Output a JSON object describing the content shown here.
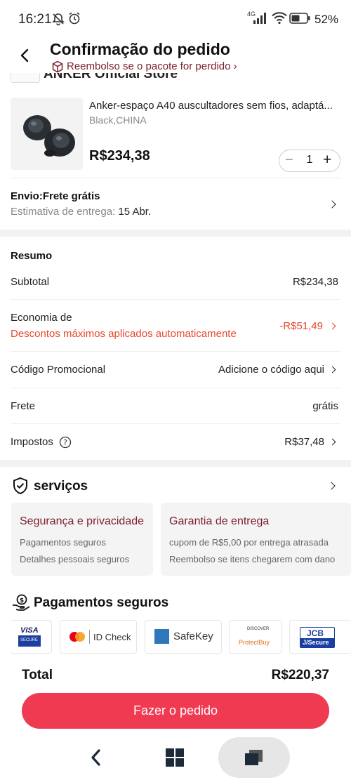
{
  "status_bar": {
    "time": "16:21",
    "network": "4G",
    "battery": "52%"
  },
  "header": {
    "title": "Confirmação do pedido",
    "subtitle": "Reembolso se o pacote for perdido ›"
  },
  "store_strip": "ANKER Official Store",
  "product": {
    "name": "Anker-espaço A40 auscultadores sem fios, adaptá...",
    "variant": "Black,CHINA",
    "price": "R$234,38",
    "quantity": "1"
  },
  "shipping": {
    "title": "Envio:Frete grátis",
    "estimate_label": "Estimativa de entrega: ",
    "estimate_date": "15 Abr."
  },
  "summary": {
    "title": "Resumo",
    "subtotal_label": "Subtotal",
    "subtotal_value": "R$234,38",
    "savings_label": "Economia de",
    "savings_note": "Descontos máximos aplicados automaticamente",
    "savings_value": "-R$51,49",
    "promo_label": "Código Promocional",
    "promo_value": "Adicione o código aqui",
    "freight_label": "Frete",
    "freight_value": "grátis",
    "taxes_label": "Impostos",
    "taxes_value": "R$37,48"
  },
  "services": {
    "title": "serviços",
    "cards": [
      {
        "title": "Segurança e privacidade",
        "line1": "Pagamentos seguros",
        "line2": "Detalhes pessoais seguros"
      },
      {
        "title": "Garantia de entrega",
        "line1": "cupom de R$5,00 por entrega atrasada",
        "line2": "Reembolso se itens chegarem com dano"
      }
    ]
  },
  "payments": {
    "title": "Pagamentos seguros",
    "badges": [
      "VISA",
      "SECURE",
      "ID Check",
      "SafeKey",
      "DISCOVER",
      "ProtectBuy",
      "JCB",
      "J/Secure"
    ]
  },
  "total": {
    "label": "Total",
    "value": "R$220,37"
  },
  "order_button": "Fazer o pedido",
  "colors": {
    "accent": "#f03a52",
    "savings": "#e8462b",
    "maroon": "#7a1f2e"
  }
}
